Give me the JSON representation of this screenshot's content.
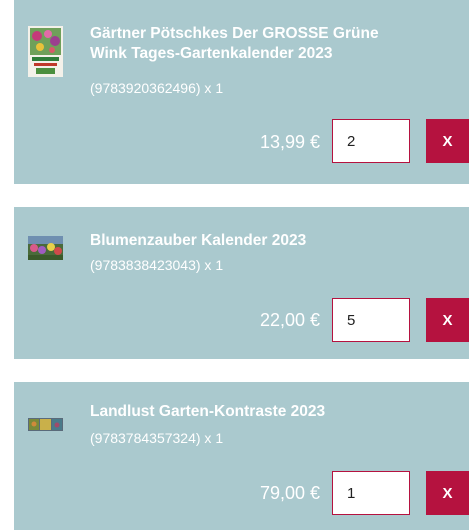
{
  "cart": {
    "items": [
      {
        "title_line1": "Gärtner Pötschkes Der GROSSE Grüne",
        "title_line2": "Wink Tages-Gartenkalender 2023",
        "subtitle": "(9783920362496) x 1",
        "price": "13,99 €",
        "quantity": "2",
        "remove_label": "X",
        "thumbnail_icon": "calendar-cover-flowers"
      },
      {
        "title_line1": "Blumenzauber Kalender 2023",
        "subtitle": "(9783838423043) x 1",
        "price": "22,00 €",
        "quantity": "5",
        "remove_label": "X",
        "thumbnail_icon": "calendar-cover-garden"
      },
      {
        "title_line1": "Landlust Garten-Kontraste 2023",
        "subtitle": "(9783784357324) x 1",
        "price": "79,00 €",
        "quantity": "1",
        "remove_label": "X",
        "thumbnail_icon": "calendar-cover-panorama"
      }
    ]
  },
  "colors": {
    "card_background": "#aac9ce",
    "accent": "#b5123f",
    "text": "#ffffff"
  }
}
